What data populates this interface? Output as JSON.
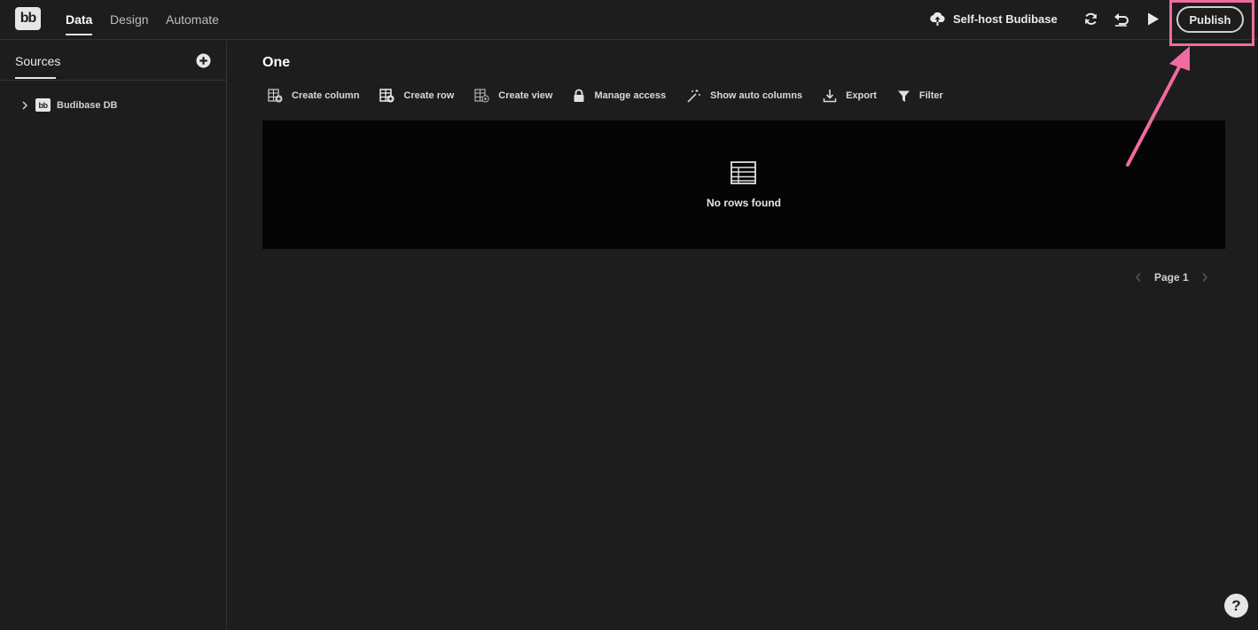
{
  "header": {
    "logo_text": "bb",
    "tabs": [
      {
        "label": "Data",
        "active": true
      },
      {
        "label": "Design",
        "active": false
      },
      {
        "label": "Automate",
        "active": false
      }
    ],
    "self_host_label": "Self-host Budibase",
    "publish_label": "Publish"
  },
  "sidebar": {
    "title": "Sources",
    "items": [
      {
        "label": "Budibase DB",
        "logo_text": "bb"
      }
    ]
  },
  "main": {
    "title": "One",
    "toolbar": [
      {
        "label": "Create column",
        "icon": "table-add-icon"
      },
      {
        "label": "Create row",
        "icon": "table-row-add-icon"
      },
      {
        "label": "Create view",
        "icon": "table-view-icon"
      },
      {
        "label": "Manage access",
        "icon": "lock-icon"
      },
      {
        "label": "Show auto columns",
        "icon": "magic-wand-icon"
      },
      {
        "label": "Export",
        "icon": "download-icon"
      },
      {
        "label": "Filter",
        "icon": "filter-icon"
      }
    ],
    "empty_text": "No rows found",
    "pagination": {
      "label": "Page 1"
    }
  },
  "help": {
    "label": "?"
  },
  "annotation": {
    "color": "#f06ba0"
  }
}
